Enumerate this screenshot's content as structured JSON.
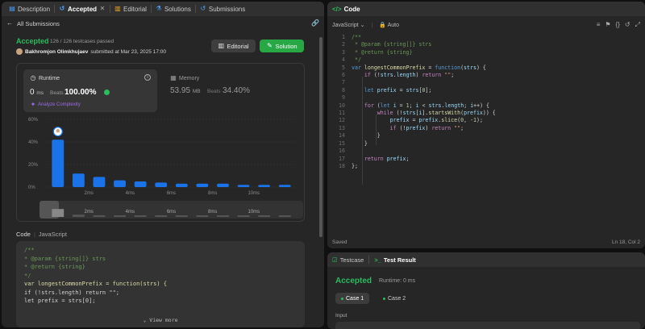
{
  "left_tabs": [
    {
      "label": "Description",
      "icon": "description-icon"
    },
    {
      "label": "Accepted",
      "icon": "history-icon",
      "active": true
    },
    {
      "label": "Editorial",
      "icon": "book-icon"
    },
    {
      "label": "Solutions",
      "icon": "flask-icon"
    },
    {
      "label": "Submissions",
      "icon": "history-icon"
    }
  ],
  "back_label": "All Submissions",
  "submission": {
    "status": "Accepted",
    "testcases": "126 / 126 testcases passed",
    "author": "Bakhromjon Olimkhujaev",
    "submitted_text": "submitted at Mar 23, 2025 17:00",
    "editorial_btn": "Editorial",
    "solution_btn": "Solution"
  },
  "runtime": {
    "title": "Runtime",
    "value": "0",
    "unit": "ms",
    "beats_label": "Beats",
    "beats_value": "100.00%",
    "analyze": "Analyze Complexity"
  },
  "memory": {
    "title": "Memory",
    "value": "53.95",
    "unit": "MB",
    "beats_label": "Beats",
    "beats_value": "34.40%"
  },
  "chart_data": {
    "type": "bar",
    "ylabel": "",
    "y_ticks": [
      "60%",
      "40%",
      "20%",
      "0%"
    ],
    "ylim": [
      0,
      60
    ],
    "x_tick_labels": [
      "2ms",
      "4ms",
      "6ms",
      "8ms",
      "10ms"
    ],
    "values": [
      42,
      12,
      9,
      6,
      5,
      4,
      3,
      3,
      3,
      2,
      2,
      2
    ],
    "highlight_index": 0,
    "accent": "#1a73e8",
    "mini_labels": [
      "2ms",
      "4ms",
      "6ms",
      "8ms",
      "10ms"
    ]
  },
  "code_section": {
    "title": "Code",
    "lang": "JavaScript",
    "view_more": "View more",
    "snippet": [
      "/**",
      " * @param {string[]} strs",
      " * @return {string}",
      " */",
      "var longestCommonPrefix = function(strs) {",
      "    if (!strs.length) return \"\";",
      "",
      "    let prefix = strs[0];"
    ]
  },
  "code_panel": {
    "title": "Code",
    "language": "JavaScript",
    "auto": "Auto",
    "saved": "Saved",
    "position": "Ln 18, Col 2",
    "line_numbers": [
      "1",
      "2",
      "3",
      "4",
      "5",
      "6",
      "7",
      "8",
      "9",
      "10",
      "11",
      "12",
      "13",
      "14",
      "15",
      "16",
      "17",
      "18"
    ]
  },
  "result_panel": {
    "tab_testcase": "Testcase",
    "tab_result": "Test Result",
    "status": "Accepted",
    "runtime": "Runtime: 0 ms",
    "case1": "Case 1",
    "case2": "Case 2",
    "input_label": "Input"
  }
}
